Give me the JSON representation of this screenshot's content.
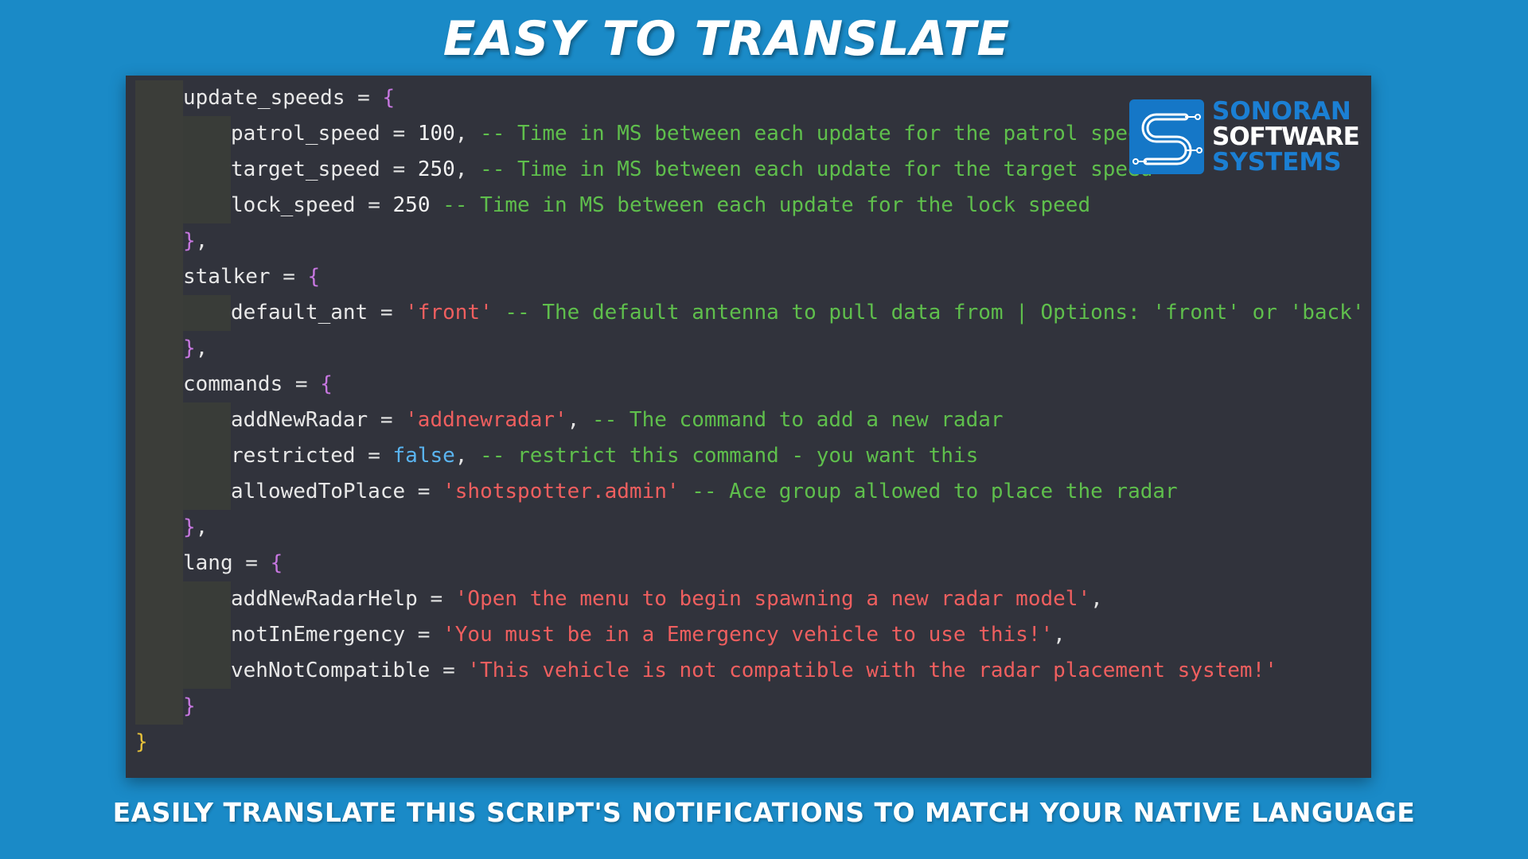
{
  "headline": "EASY TO TRANSLATE",
  "footer": "EASILY TRANSLATE THIS SCRIPT'S NOTIFICATIONS TO MATCH YOUR NATIVE LANGUAGE",
  "logo": {
    "line1": "SONORAN",
    "line2": "SOFTWARE",
    "line3": "SYSTEMS",
    "mark_icon": "sonoran-s-circuit-icon",
    "color": "#1577c7"
  },
  "colors": {
    "background": "#1a8ac7",
    "editor_bg": "#31333c",
    "string": "#ef5f5f",
    "comment": "#5fbf4c",
    "brace": "#c777e0",
    "boolean": "#5ab4f0"
  },
  "code_lines": [
    {
      "indent": 1,
      "tokens": [
        {
          "t": "update_speeds",
          "c": "ident"
        },
        {
          "t": " = ",
          "c": "op"
        },
        {
          "t": "{",
          "c": "brace"
        }
      ]
    },
    {
      "indent": 2,
      "tokens": [
        {
          "t": "patrol_speed",
          "c": "ident"
        },
        {
          "t": " = ",
          "c": "op"
        },
        {
          "t": "100",
          "c": "num"
        },
        {
          "t": ", ",
          "c": "op"
        },
        {
          "t": "-- Time in MS between each update for the patrol speed",
          "c": "comment"
        }
      ]
    },
    {
      "indent": 2,
      "tokens": [
        {
          "t": "target_speed",
          "c": "ident"
        },
        {
          "t": " = ",
          "c": "op"
        },
        {
          "t": "250",
          "c": "num"
        },
        {
          "t": ", ",
          "c": "op"
        },
        {
          "t": "-- Time in MS between each update for the target speed",
          "c": "comment"
        }
      ]
    },
    {
      "indent": 2,
      "tokens": [
        {
          "t": "lock_speed",
          "c": "ident"
        },
        {
          "t": " = ",
          "c": "op"
        },
        {
          "t": "250",
          "c": "num"
        },
        {
          "t": " ",
          "c": "op"
        },
        {
          "t": "-- Time in MS between each update for the lock speed",
          "c": "comment"
        }
      ]
    },
    {
      "indent": 1,
      "tokens": [
        {
          "t": "}",
          "c": "brace"
        },
        {
          "t": ",",
          "c": "op"
        }
      ]
    },
    {
      "indent": 1,
      "tokens": [
        {
          "t": "stalker",
          "c": "ident"
        },
        {
          "t": " = ",
          "c": "op"
        },
        {
          "t": "{",
          "c": "brace"
        }
      ]
    },
    {
      "indent": 2,
      "tokens": [
        {
          "t": "default_ant",
          "c": "ident"
        },
        {
          "t": " = ",
          "c": "op"
        },
        {
          "t": "'front'",
          "c": "str"
        },
        {
          "t": " ",
          "c": "op"
        },
        {
          "t": "-- The default antenna to pull data from | Options: 'front' or 'back'",
          "c": "comment"
        }
      ]
    },
    {
      "indent": 1,
      "tokens": [
        {
          "t": "}",
          "c": "brace"
        },
        {
          "t": ",",
          "c": "op"
        }
      ]
    },
    {
      "indent": 1,
      "tokens": [
        {
          "t": "commands",
          "c": "ident"
        },
        {
          "t": " = ",
          "c": "op"
        },
        {
          "t": "{",
          "c": "brace"
        }
      ]
    },
    {
      "indent": 2,
      "tokens": [
        {
          "t": "addNewRadar",
          "c": "ident"
        },
        {
          "t": " = ",
          "c": "op"
        },
        {
          "t": "'addnewradar'",
          "c": "str"
        },
        {
          "t": ", ",
          "c": "op"
        },
        {
          "t": "-- The command to add a new radar",
          "c": "comment"
        }
      ]
    },
    {
      "indent": 2,
      "tokens": [
        {
          "t": "restricted",
          "c": "ident"
        },
        {
          "t": " = ",
          "c": "op"
        },
        {
          "t": "false",
          "c": "bool"
        },
        {
          "t": ", ",
          "c": "op"
        },
        {
          "t": "-- restrict this command - you want this",
          "c": "comment"
        }
      ]
    },
    {
      "indent": 2,
      "tokens": [
        {
          "t": "allowedToPlace",
          "c": "ident"
        },
        {
          "t": " = ",
          "c": "op"
        },
        {
          "t": "'shotspotter.admin'",
          "c": "str"
        },
        {
          "t": " ",
          "c": "op"
        },
        {
          "t": "-- Ace group allowed to place the radar",
          "c": "comment"
        }
      ]
    },
    {
      "indent": 1,
      "tokens": [
        {
          "t": "}",
          "c": "brace"
        },
        {
          "t": ",",
          "c": "op"
        }
      ]
    },
    {
      "indent": 1,
      "tokens": [
        {
          "t": "lang",
          "c": "ident"
        },
        {
          "t": " = ",
          "c": "op"
        },
        {
          "t": "{",
          "c": "brace"
        }
      ]
    },
    {
      "indent": 2,
      "tokens": [
        {
          "t": "addNewRadarHelp",
          "c": "ident"
        },
        {
          "t": " = ",
          "c": "op"
        },
        {
          "t": "'Open the menu to begin spawning a new radar model'",
          "c": "str"
        },
        {
          "t": ",",
          "c": "op"
        }
      ]
    },
    {
      "indent": 2,
      "tokens": [
        {
          "t": "notInEmergency",
          "c": "ident"
        },
        {
          "t": " = ",
          "c": "op"
        },
        {
          "t": "'You must be in a Emergency vehicle to use this!'",
          "c": "str"
        },
        {
          "t": ",",
          "c": "op"
        }
      ]
    },
    {
      "indent": 2,
      "tokens": [
        {
          "t": "vehNotCompatible",
          "c": "ident"
        },
        {
          "t": " = ",
          "c": "op"
        },
        {
          "t": "'This vehicle is not compatible with the radar placement system!'",
          "c": "str"
        }
      ]
    },
    {
      "indent": 1,
      "tokens": [
        {
          "t": "}",
          "c": "brace"
        }
      ]
    },
    {
      "indent": 0,
      "tokens": [
        {
          "t": "}",
          "c": "brace-top"
        }
      ]
    }
  ]
}
